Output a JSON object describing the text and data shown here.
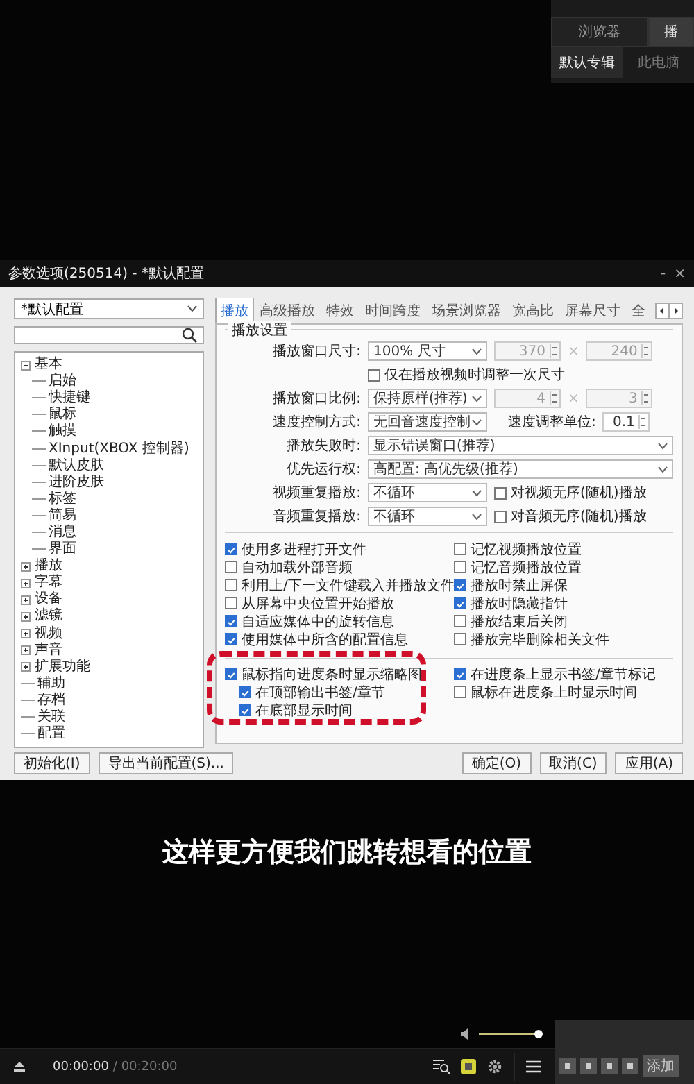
{
  "side_panel": {
    "tabs": [
      {
        "label": "浏览器",
        "selected": false
      },
      {
        "label": "播",
        "selected": true
      }
    ],
    "subtabs": [
      {
        "label": "默认专辑",
        "selected": true
      },
      {
        "label": "此电脑",
        "selected": false
      }
    ]
  },
  "dialog": {
    "title": "参数选项(250514) - *默认配置",
    "window_controls": [
      "-",
      "×"
    ],
    "profile": "*默认配置",
    "tree": [
      {
        "label": "基本",
        "kind": "folder",
        "expanded": true,
        "children": [
          {
            "label": "启始"
          },
          {
            "label": "快捷键"
          },
          {
            "label": "鼠标"
          },
          {
            "label": "触摸"
          },
          {
            "label": "XInput(XBOX 控制器)"
          },
          {
            "label": "默认皮肤"
          },
          {
            "label": "进阶皮肤"
          },
          {
            "label": "标签"
          },
          {
            "label": "简易"
          },
          {
            "label": "消息"
          },
          {
            "label": "界面"
          }
        ]
      },
      {
        "label": "播放",
        "kind": "folder",
        "expanded": false
      },
      {
        "label": "字幕",
        "kind": "folder",
        "expanded": false
      },
      {
        "label": "设备",
        "kind": "folder",
        "expanded": false
      },
      {
        "label": "滤镜",
        "kind": "folder",
        "expanded": false
      },
      {
        "label": "视频",
        "kind": "folder",
        "expanded": false
      },
      {
        "label": "声音",
        "kind": "folder",
        "expanded": false
      },
      {
        "label": "扩展功能",
        "kind": "folder",
        "expanded": false
      },
      {
        "label": "辅助",
        "kind": "leaf"
      },
      {
        "label": "存档",
        "kind": "leaf"
      },
      {
        "label": "关联",
        "kind": "leaf"
      },
      {
        "label": "配置",
        "kind": "leaf"
      }
    ],
    "tabs": [
      {
        "label": "播放",
        "selected": true
      },
      {
        "label": "高级播放",
        "selected": false
      },
      {
        "label": "特效",
        "selected": false
      },
      {
        "label": "时间跨度",
        "selected": false
      },
      {
        "label": "场景浏览器",
        "selected": false
      },
      {
        "label": "宽高比",
        "selected": false
      },
      {
        "label": "屏幕尺寸",
        "selected": false
      },
      {
        "label": "全",
        "selected": false
      }
    ],
    "group_title": "播放设置",
    "rows": [
      {
        "kind": "pair",
        "label": "播放窗口尺寸:",
        "select": "100% 尺寸",
        "first": "370",
        "sign": "×",
        "second": "240",
        "disabled": true
      },
      {
        "kind": "check",
        "label": "仅在播放视频时调整一次尺寸",
        "checked": false
      },
      {
        "kind": "pair",
        "label": "播放窗口比例:",
        "select": "保持原样(推荐)",
        "first": "4",
        "sign": "×",
        "second": "3",
        "disabled": true
      },
      {
        "kind": "speed",
        "label": "速度控制方式:",
        "select": "无回音速度控制",
        "unit_label": "速度调整单位:",
        "unit": "0.1"
      },
      {
        "kind": "wide",
        "label": "播放失败时:",
        "select": "显示错误窗口(推荐)"
      },
      {
        "kind": "wide",
        "label": "优先运行权:",
        "select": "高配置: 高优先级(推荐)"
      },
      {
        "kind": "repeat",
        "label": "视频重复播放:",
        "select": "不循环",
        "option": "对视频无序(随机)播放",
        "checked": false
      },
      {
        "kind": "repeat",
        "label": "音频重复播放:",
        "select": "不循环",
        "option": "对音频无序(随机)播放",
        "checked": false
      }
    ],
    "options_left": [
      {
        "label": "使用多进程打开文件",
        "checked": true
      },
      {
        "label": "自动加载外部音频",
        "checked": false
      },
      {
        "label": "利用上/下一文件键载入并播放文件",
        "checked": false
      },
      {
        "label": "从屏幕中央位置开始播放",
        "checked": false
      },
      {
        "label": "自适应媒体中的旋转信息",
        "checked": true
      },
      {
        "label": "使用媒体中所含的配置信息",
        "checked": true
      }
    ],
    "options_right": [
      {
        "label": "记忆视频播放位置",
        "checked": false
      },
      {
        "label": "记忆音频播放位置",
        "checked": false
      },
      {
        "label": "播放时禁止屏保",
        "checked": true
      },
      {
        "label": "播放时隐藏指针",
        "checked": true
      },
      {
        "label": "播放结束后关闭",
        "checked": false
      },
      {
        "label": "播放完毕删除相关文件",
        "checked": false
      }
    ],
    "thumb_option": {
      "label": "鼠标指向进度条时显示缩略图",
      "checked": true,
      "children": [
        {
          "label": "在顶部输出书签/章节",
          "checked": true
        },
        {
          "label": "在底部显示时间",
          "checked": true
        }
      ]
    },
    "seek_options": [
      {
        "label": "在进度条上显示书签/章节标记",
        "checked": true
      },
      {
        "label": "鼠标在进度条上时显示时间",
        "checked": false
      }
    ],
    "buttons_left": [
      "初始化(I)",
      "导出当前配置(S)..."
    ],
    "buttons_right": [
      "确定(O)",
      "取消(C)",
      "应用(A)"
    ]
  },
  "caption": "这样更方便我们跳转想看的位置",
  "player": {
    "volume": {
      "level": 0.95
    },
    "elapsed": "00:00:00",
    "total": "/ 00:20:00",
    "add_button": "添加"
  }
}
